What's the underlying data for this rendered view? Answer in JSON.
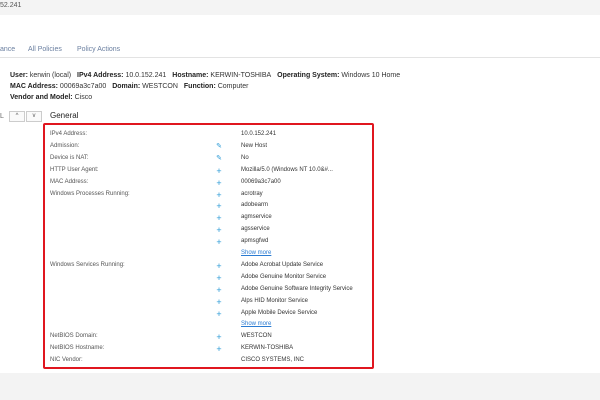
{
  "address_fragment": "52.241",
  "tabs": [
    "ance",
    "All Policies",
    "Policy Actions"
  ],
  "host": {
    "user_key": "User:",
    "user_val": "kerwin (local)",
    "ipv4_key": "IPv4 Address:",
    "ipv4_val": "10.0.152.241",
    "hostname_key": "Hostname:",
    "hostname_val": "KERWIN-TOSHIBA",
    "os_key": "Operating System:",
    "os_val": "Windows 10 Home",
    "mac_key": "MAC Address:",
    "mac_val": "00069a3c7a00",
    "domain_key": "Domain:",
    "domain_val": "WESTCON",
    "function_key": "Function:",
    "function_val": "Computer",
    "vendor_key": "Vendor and Model:",
    "vendor_val": "Cisco"
  },
  "left_controls": {
    "page_text": "L",
    "up": "^",
    "down": "v"
  },
  "panel_title": "General",
  "rows": [
    {
      "label": "IPv4 Address:",
      "icon": "",
      "value": "10.0.152.241"
    },
    {
      "label": "Admission:",
      "icon": "edit-icon",
      "value": "New Host"
    },
    {
      "label": "Device is NAT:",
      "icon": "edit-icon",
      "value": "No"
    },
    {
      "label": "HTTP User Agent:",
      "icon": "plus-icon",
      "value": "Mozilla/5.0 (Windows NT 10.0&#..."
    },
    {
      "label": "MAC Address:",
      "icon": "plus-icon",
      "value": "00069a3c7a00"
    },
    {
      "label": "Windows Processes Running:",
      "icon": "plus-icon",
      "value": "acrotray"
    },
    {
      "label": "",
      "icon": "plus-icon",
      "value": "adobearm"
    },
    {
      "label": "",
      "icon": "plus-icon",
      "value": "agmservice"
    },
    {
      "label": "",
      "icon": "plus-icon",
      "value": "agsservice"
    },
    {
      "label": "",
      "icon": "plus-icon",
      "value": "apmsgfwd"
    },
    {
      "label": "",
      "icon": "",
      "value": "Show more",
      "link": true
    },
    {
      "label": "Windows Services Running:",
      "icon": "plus-icon",
      "value": "Adobe Acrobat Update Service"
    },
    {
      "label": "",
      "icon": "plus-icon",
      "value": "Adobe Genuine Monitor Service"
    },
    {
      "label": "",
      "icon": "plus-icon",
      "value": "Adobe Genuine Software Integrity Service"
    },
    {
      "label": "",
      "icon": "plus-icon",
      "value": "Alps HID Monitor Service"
    },
    {
      "label": "",
      "icon": "plus-icon",
      "value": "Apple Mobile Device Service"
    },
    {
      "label": "",
      "icon": "",
      "value": "Show more",
      "link": true
    },
    {
      "label": "NetBIOS Domain:",
      "icon": "plus-icon",
      "value": "WESTCON"
    },
    {
      "label": "NetBIOS Hostname:",
      "icon": "plus-icon",
      "value": "KERWIN-TOSHIBA"
    },
    {
      "label": "NIC Vendor:",
      "icon": "",
      "value": "CISCO SYSTEMS, INC"
    }
  ],
  "colors": {
    "highlight": "#e0161f",
    "icon": "#2a9ad6",
    "link": "#2a7bd2"
  }
}
